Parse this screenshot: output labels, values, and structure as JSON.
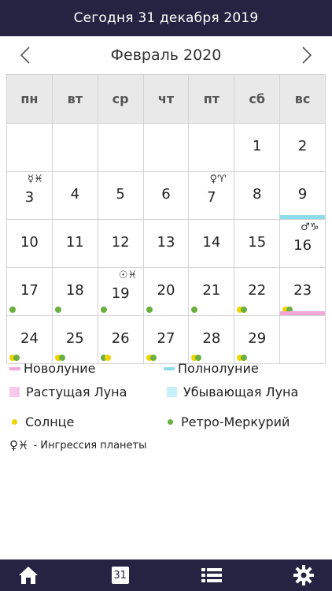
{
  "header": {
    "today_label": "Сегодня 31 декабря 2019"
  },
  "month_nav": {
    "title": "Февраль 2020",
    "prev_icon": "chevron-left-icon",
    "next_icon": "chevron-right-icon"
  },
  "weekdays": [
    "пн",
    "вт",
    "ср",
    "чт",
    "пт",
    "сб",
    "вс"
  ],
  "colors": {
    "bar_bg": "#262342",
    "new_moon": "#f4a6d9",
    "full_moon": "#8ddcea",
    "sun": "#f0d400",
    "retro_mercury": "#6aaf3f"
  },
  "calendar": {
    "weeks": [
      [
        {
          "day": ""
        },
        {
          "day": ""
        },
        {
          "day": ""
        },
        {
          "day": ""
        },
        {
          "day": ""
        },
        {
          "day": "1"
        },
        {
          "day": "2"
        }
      ],
      [
        {
          "day": "3",
          "mark": "☿♓"
        },
        {
          "day": "4"
        },
        {
          "day": "5"
        },
        {
          "day": "6"
        },
        {
          "day": "7",
          "mark": "♀♈"
        },
        {
          "day": "8"
        },
        {
          "day": "9",
          "bar": "full"
        }
      ],
      [
        {
          "day": "10"
        },
        {
          "day": "11"
        },
        {
          "day": "12"
        },
        {
          "day": "13"
        },
        {
          "day": "14"
        },
        {
          "day": "15"
        },
        {
          "day": "16",
          "mark": "♂♑"
        }
      ],
      [
        {
          "day": "17",
          "dots": [
            "green"
          ]
        },
        {
          "day": "18",
          "dots": [
            "green"
          ]
        },
        {
          "day": "19",
          "mark": "☉♓",
          "dots": [
            "green"
          ]
        },
        {
          "day": "20",
          "dots": [
            "green"
          ]
        },
        {
          "day": "21",
          "dots": [
            "green"
          ]
        },
        {
          "day": "22",
          "dots": [
            "yellow",
            "green"
          ]
        },
        {
          "day": "23",
          "dots": [
            "yellow",
            "green"
          ],
          "bar": "new"
        }
      ],
      [
        {
          "day": "24",
          "dots": [
            "yellow",
            "green"
          ]
        },
        {
          "day": "25",
          "dots": [
            "yellow",
            "green"
          ]
        },
        {
          "day": "26",
          "dots": [
            "green",
            "yellow"
          ]
        },
        {
          "day": "27",
          "dots": [
            "yellow",
            "green"
          ]
        },
        {
          "day": "28",
          "dots": [
            "yellow",
            "green"
          ]
        },
        {
          "day": "29",
          "dots": [
            "yellow",
            "green"
          ]
        },
        {
          "day": ""
        }
      ]
    ]
  },
  "legend": {
    "new_moon": "Новолуние",
    "full_moon": "Полнолуние",
    "waxing_moon": "Растущая Луна",
    "waning_moon": "Убывающая Луна",
    "sun": "Солнце",
    "retro_mercury": "Ретро-Меркурий",
    "ingress_symbols": "♀♓",
    "ingress": "- Ингрессия планеты"
  },
  "bottom_nav": {
    "home_icon": "home-icon",
    "calendar_day": "31",
    "list_icon": "list-icon",
    "settings_icon": "gear-icon"
  }
}
